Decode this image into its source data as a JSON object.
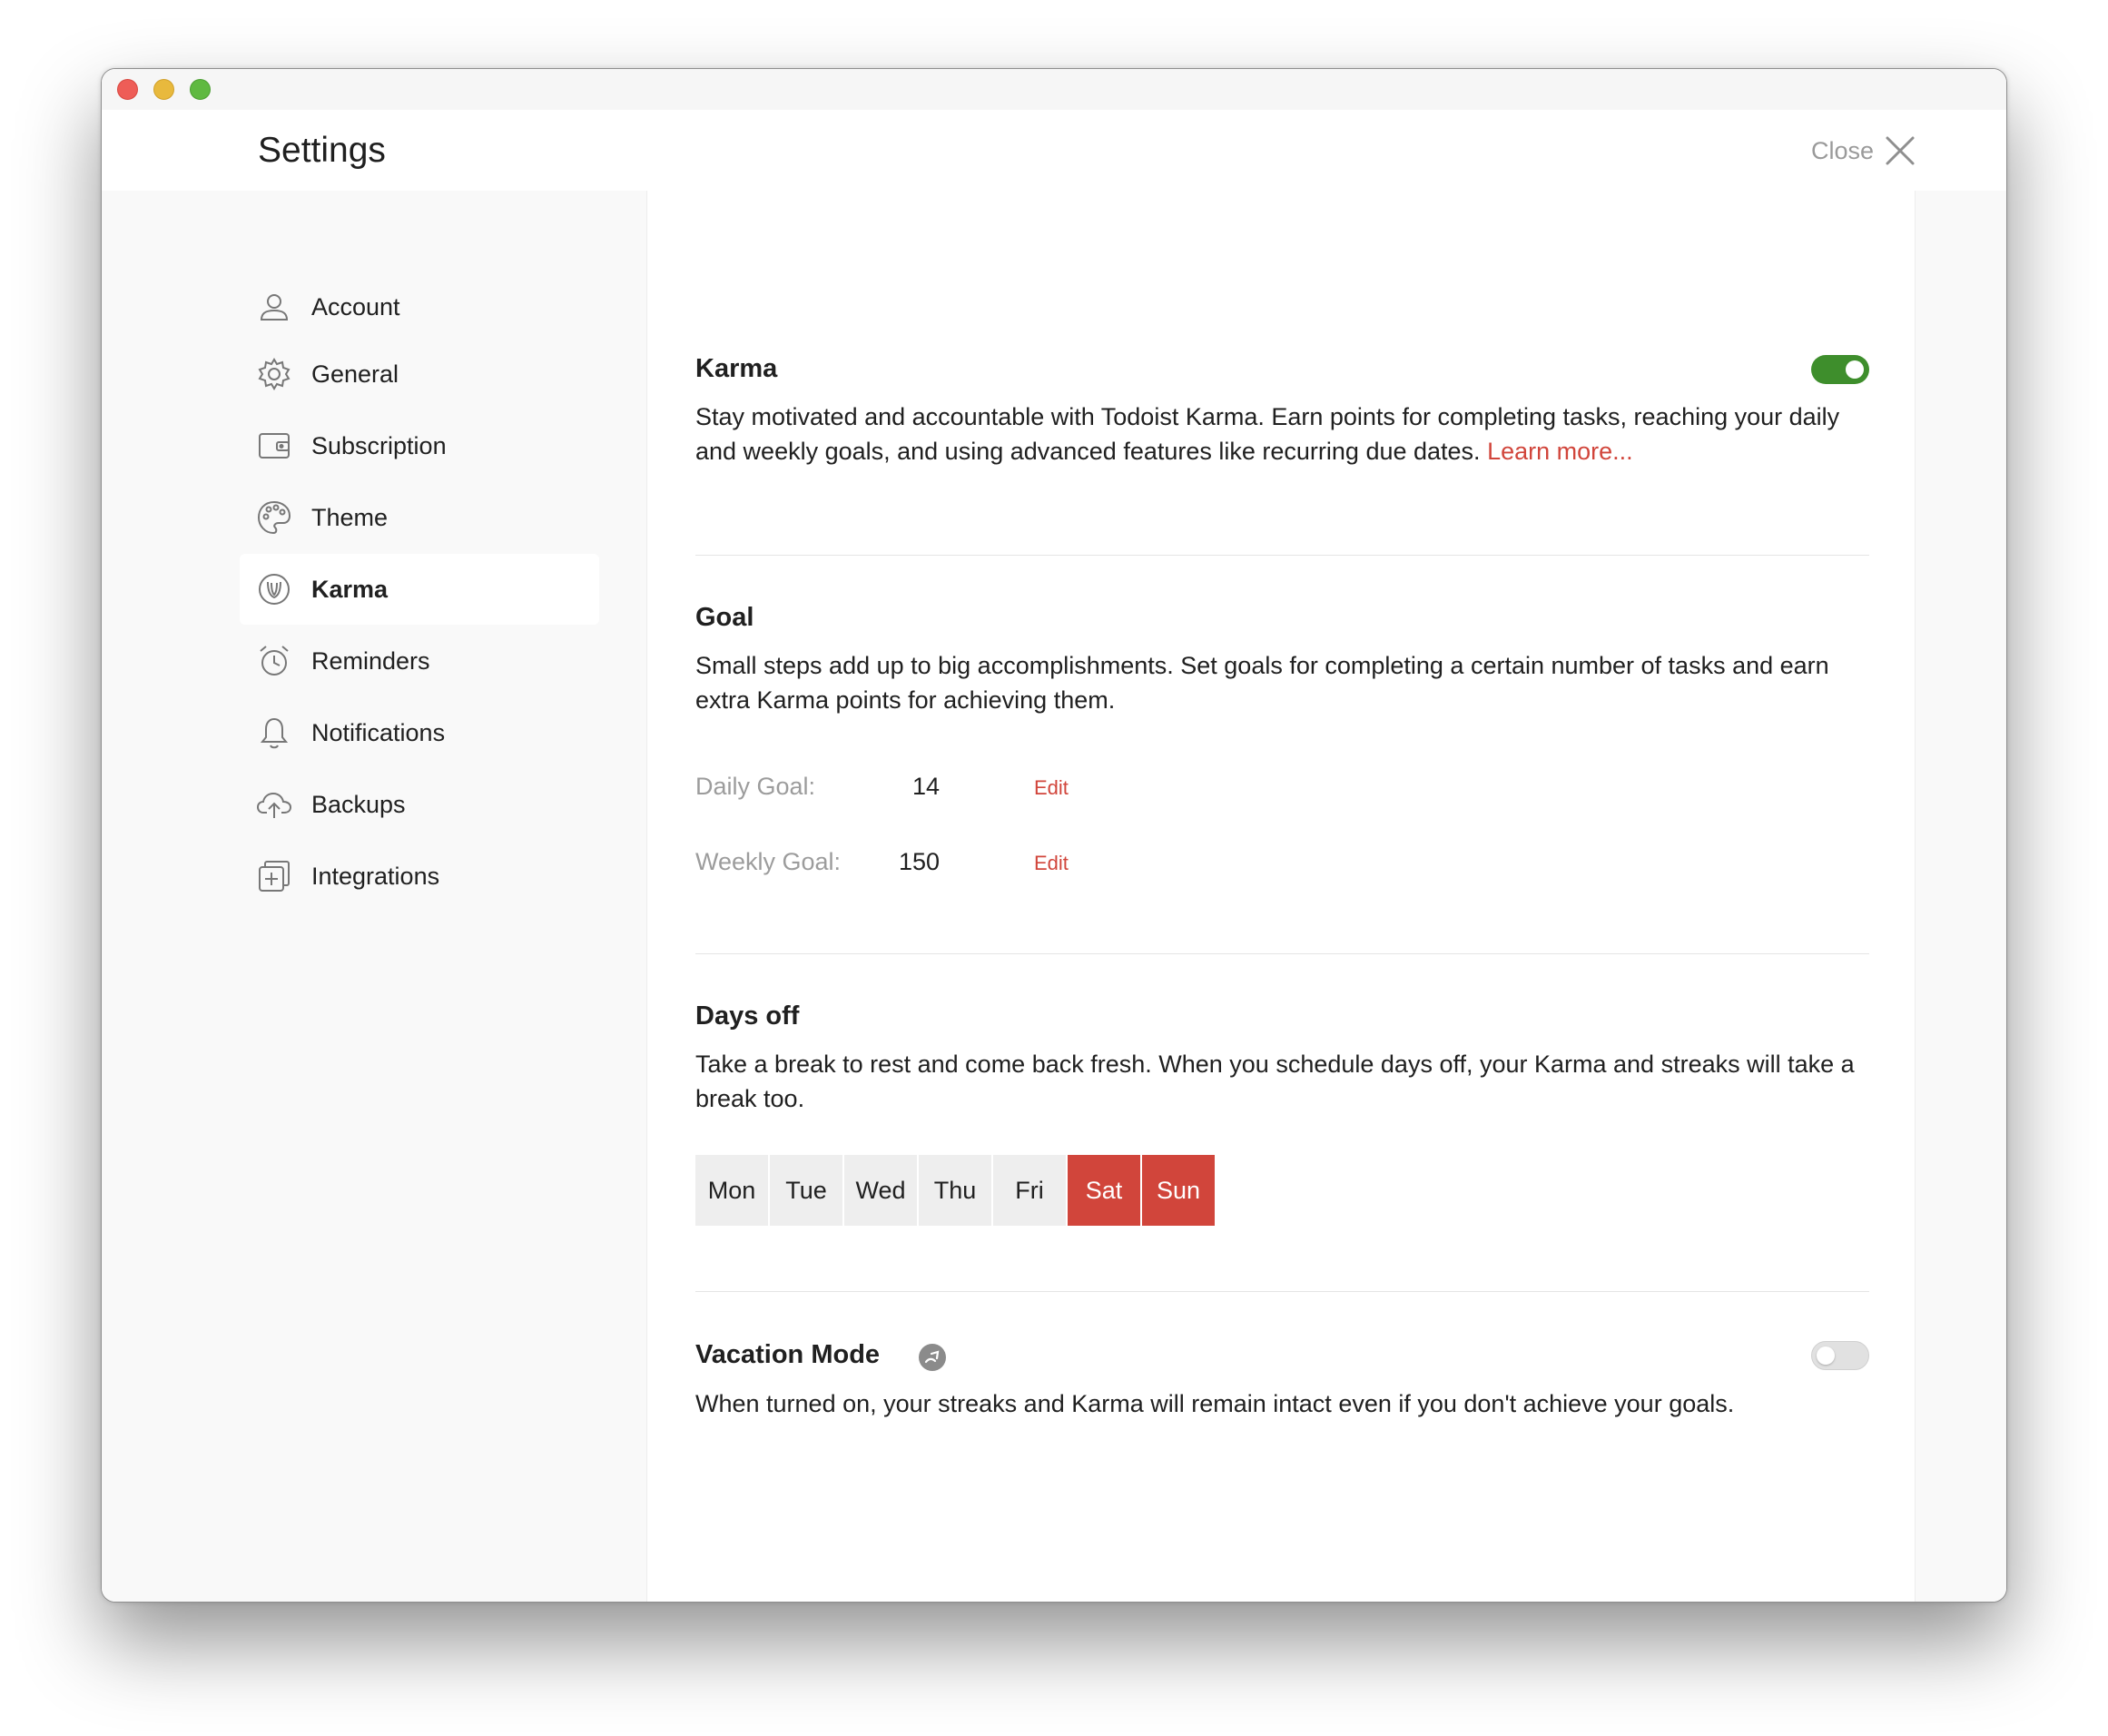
{
  "window": {
    "title": "Settings",
    "close_label": "Close"
  },
  "sidebar": {
    "items": [
      {
        "label": "Account",
        "icon": "person-icon"
      },
      {
        "label": "General",
        "icon": "gear-icon"
      },
      {
        "label": "Subscription",
        "icon": "wallet-icon"
      },
      {
        "label": "Theme",
        "icon": "palette-icon"
      },
      {
        "label": "Karma",
        "icon": "karma-icon",
        "active": true
      },
      {
        "label": "Reminders",
        "icon": "alarm-clock-icon"
      },
      {
        "label": "Notifications",
        "icon": "bell-icon"
      },
      {
        "label": "Backups",
        "icon": "cloud-upload-icon"
      },
      {
        "label": "Integrations",
        "icon": "plus-square-icon"
      }
    ]
  },
  "karma": {
    "title": "Karma",
    "enabled": true,
    "description": "Stay motivated and accountable with Todoist Karma. Earn points for completing tasks, reaching your daily and weekly goals, and using advanced features like recurring due dates.",
    "learn_more": "Learn more..."
  },
  "goal": {
    "title": "Goal",
    "description": "Small steps add up to big accomplishments. Set goals for completing a certain number of tasks and earn extra Karma points for achieving them.",
    "daily_label": "Daily Goal:",
    "daily_value": "14",
    "weekly_label": "Weekly Goal:",
    "weekly_value": "150",
    "edit_label": "Edit"
  },
  "days_off": {
    "title": "Days off",
    "description": "Take a break to rest and come back fresh. When you schedule days off, your Karma and streaks will take a break too.",
    "days": [
      {
        "label": "Mon",
        "off": false
      },
      {
        "label": "Tue",
        "off": false
      },
      {
        "label": "Wed",
        "off": false
      },
      {
        "label": "Thu",
        "off": false
      },
      {
        "label": "Fri",
        "off": false
      },
      {
        "label": "Sat",
        "off": true
      },
      {
        "label": "Sun",
        "off": true
      }
    ]
  },
  "vacation": {
    "title": "Vacation Mode",
    "enabled": false,
    "description": "When turned on, your streaks and Karma will remain intact even if you don't achieve your goals."
  },
  "colors": {
    "accent": "#d1453b",
    "toggle_on": "#3e8e2c",
    "sidebar_bg": "#f9f9f9"
  }
}
